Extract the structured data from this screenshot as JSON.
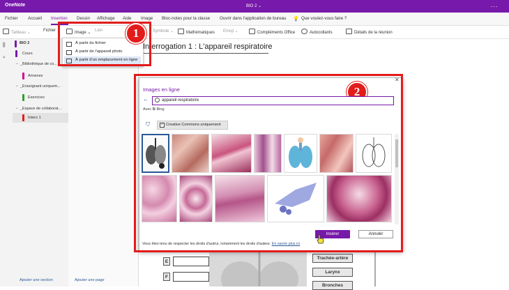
{
  "app": {
    "name": "OneNote",
    "notebook": "BIO 2 ⌄",
    "more": "..."
  },
  "menu": {
    "items": [
      "Fichier",
      "Accueil",
      "Insertion",
      "Dessin",
      "Affichage",
      "Aide",
      "Image",
      "Bloc-notes pour la classe",
      "Ouvrir dans l'application de bureau",
      "Que voulez-vous faire ?"
    ],
    "active": "Insertion"
  },
  "ribbon": {
    "tableau": "Tableau ⌄",
    "fichier": "Fichier",
    "image": "Image ⌄",
    "lien": "Lien",
    "symbole": "Symbole ⌄",
    "maths": "Mathématiques",
    "emoji": "Emoji ⌄",
    "complements": "Compléments Office",
    "autocollants": "Autocollants",
    "details": "Détails de la réunion"
  },
  "dropdown": {
    "items": [
      "À partir du fichier",
      "À partir de l'appareil photo",
      "À partir d'un emplacement en ligne"
    ]
  },
  "badges": {
    "one": "1",
    "two": "2"
  },
  "nav": {
    "notebook": "BIO 2",
    "sections": [
      "Cours",
      "_Bibliothèque de co...",
      "Annexes",
      "_Enseignant uniquem...",
      "Exercices",
      "_Espace de collaborat...",
      "Intero 1"
    ]
  },
  "footer": {
    "add_section": "Ajouter une section",
    "add_page": "Ajouter une page"
  },
  "page": {
    "title": "Interrogation 1 : L'appareil respiratoire"
  },
  "dialog": {
    "title": "Images en ligne",
    "search_value": "appareil respiratoire",
    "with": "Avec",
    "provider": "Bing",
    "cc_label": "Creative Commons uniquement",
    "notice": "Vous êtes tenu de respecter les droits d'autrui, notamment les droits d'auteur.",
    "learn_more": "En savoir plus ici",
    "insert": "Insérer",
    "cancel": "Annuler",
    "close": "✕"
  },
  "worksheet": {
    "letters": [
      "E",
      "F"
    ],
    "labels": [
      "Trachée-artère",
      "Larynx",
      "Bronches"
    ]
  },
  "colors": {
    "brand": "#7719aa",
    "highlight": "#e31b1b",
    "link": "#2b5797"
  }
}
